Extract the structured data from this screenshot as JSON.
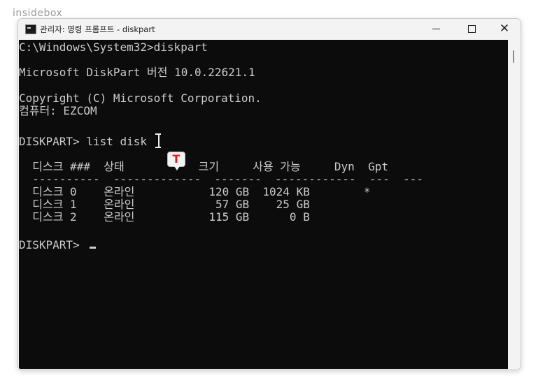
{
  "watermark": {
    "text": "insidebox"
  },
  "window": {
    "title": "관리자: 명령 프롬프트 - diskpart",
    "icon": "cmd-icon",
    "controls": {
      "minimize_icon": "minimize-icon",
      "maximize_icon": "maximize-icon",
      "close_label": "✕"
    }
  },
  "console": {
    "lines": [
      "C:\\Windows\\System32>diskpart",
      "",
      "Microsoft DiskPart 버전 10.0.22621.1",
      "",
      "Copyright (C) Microsoft Corporation.",
      "컴퓨터: EZCOM",
      "",
      "DISKPART> list disk",
      "",
      "  디스크 ###  상태           크기     사용 가능     Dyn  Gpt",
      "  ----------  -------------  -------  ------------  ---  ---",
      "  디스크 0    온라인           120 GB  1024 KB        *",
      "  디스크 1    온라인            57 GB    25 GB",
      "  디스크 2    온라인           115 GB      0 B",
      "",
      "DISKPART> "
    ]
  },
  "overlay": {
    "badge_letter": "T",
    "cursor_icon": "text-cursor-icon"
  }
}
